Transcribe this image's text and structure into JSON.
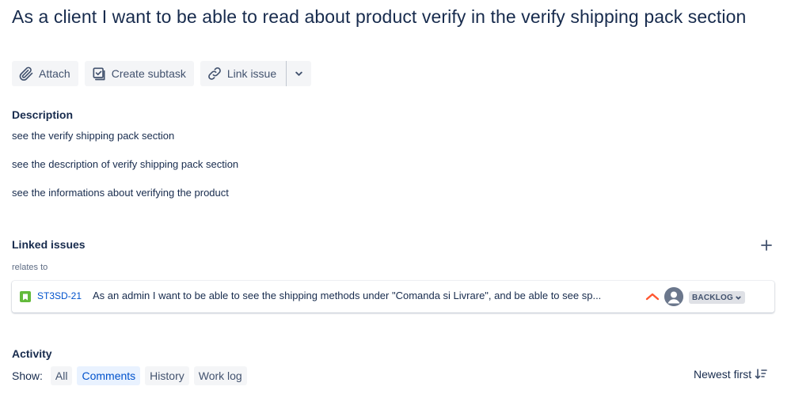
{
  "issue": {
    "title": "As a client I want to be able to read about product verify in the verify shipping pack section"
  },
  "toolbar": {
    "attach": "Attach",
    "create_subtask": "Create subtask",
    "link_issue": "Link issue"
  },
  "description": {
    "heading": "Description",
    "lines": [
      "see the verify shipping pack section",
      "see the description of verify shipping pack section",
      "see the informations about verifying the product"
    ]
  },
  "linked_issues": {
    "heading": "Linked issues",
    "relation": "relates to",
    "items": [
      {
        "key": "ST3SD-21",
        "summary": "As an admin I want to be able to see the shipping methods under \"Comanda si Livrare\", and be able to see sp...",
        "status": "BACKLOG",
        "type_icon": "story-icon",
        "priority_icon": "priority-high-icon",
        "assignee_icon": "unassigned-avatar-icon"
      }
    ]
  },
  "activity": {
    "heading": "Activity",
    "show_label": "Show:",
    "filters": [
      "All",
      "Comments",
      "History",
      "Work log"
    ],
    "active_filter": "Comments",
    "sort_label": "Newest first"
  },
  "colors": {
    "accent": "#0052cc",
    "story": "#63ba3c",
    "priority_high": "#ff5630"
  }
}
